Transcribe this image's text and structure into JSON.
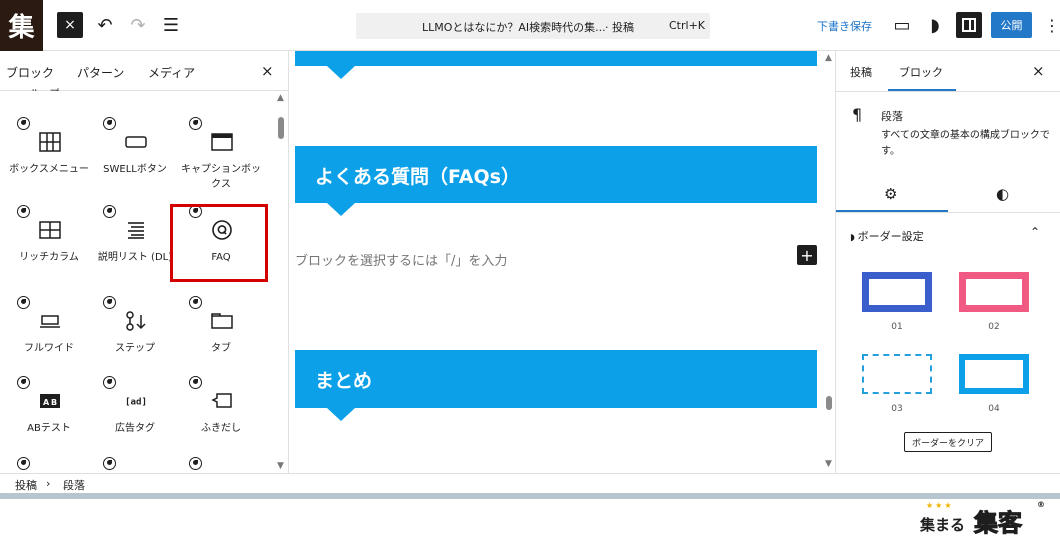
{
  "topbar": {
    "logo_text": "集",
    "close_icon": "×",
    "undo_icon": "↶",
    "redo_icon": "↷",
    "outline_icon": "☰",
    "command_title": "LLMOとはなにか？AI検索時代の集...",
    "command_type": "· 投稿",
    "command_shortcut": "Ctrl+K",
    "save_draft": "下書き保存",
    "preview_icon": "▭",
    "swell_icon": "◗",
    "publish": "公開",
    "more_icon": "⋮"
  },
  "inserter": {
    "tabs": [
      "ブロック",
      "パターン",
      "メディア"
    ],
    "close_icon": "×",
    "cut_labels": [
      "ループ",
      "ー"
    ],
    "blocks": [
      {
        "label": "ボックスメニュー",
        "icon": "grid-menu-icon"
      },
      {
        "label": "SWELLボタン",
        "icon": "button-icon"
      },
      {
        "label": "キャプションボックス",
        "icon": "caption-box-icon"
      },
      {
        "label": "リッチカラム",
        "icon": "rich-column-icon"
      },
      {
        "label": "説明リスト (DL)",
        "icon": "description-list-icon"
      },
      {
        "label": "FAQ",
        "icon": "faq-icon"
      },
      {
        "label": "フルワイド",
        "icon": "full-wide-icon"
      },
      {
        "label": "ステップ",
        "icon": "step-icon"
      },
      {
        "label": "タブ",
        "icon": "tab-icon"
      },
      {
        "label": "ABテスト",
        "icon": "ab-test-icon"
      },
      {
        "label": "広告タグ",
        "icon": "ad-tag-icon"
      },
      {
        "label": "ふきだし",
        "icon": "balloon-icon"
      }
    ]
  },
  "canvas": {
    "heading_faq": "よくある質問（FAQs）",
    "placeholder": "ブロックを選択するには「/」を入力",
    "add_icon": "+",
    "heading_matome": "まとめ"
  },
  "settings": {
    "tabs": [
      "投稿",
      "ブロック"
    ],
    "close_icon": "×",
    "block_icon": "¶",
    "block_title": "段落",
    "block_desc": "すべての文章の基本の構成ブロックです。",
    "settings_icon": "⚙",
    "styles_icon": "◐",
    "panel_title": "ボーダー設定",
    "panel_toggle": "⌃",
    "border_options": [
      {
        "label": "01",
        "color": "#3a5fcd",
        "style": "solid"
      },
      {
        "label": "02",
        "color": "#f05a82",
        "style": "solid"
      },
      {
        "label": "03",
        "color": "#23a0dc",
        "style": "dashed"
      },
      {
        "label": "04",
        "color": "#0ca0e8",
        "style": "solid"
      }
    ],
    "clear_button": "ボーダーをクリア"
  },
  "breadcrumb": {
    "items": [
      "投稿",
      "段落"
    ],
    "separator": "›"
  },
  "watermark": {
    "stars": "★★★",
    "small": "集まる",
    "big": "集客",
    "reg": "®"
  },
  "colors": {
    "accent_blue": "#2478c8",
    "heading_blue": "#0ca0e8",
    "highlight_red": "#d40000"
  }
}
